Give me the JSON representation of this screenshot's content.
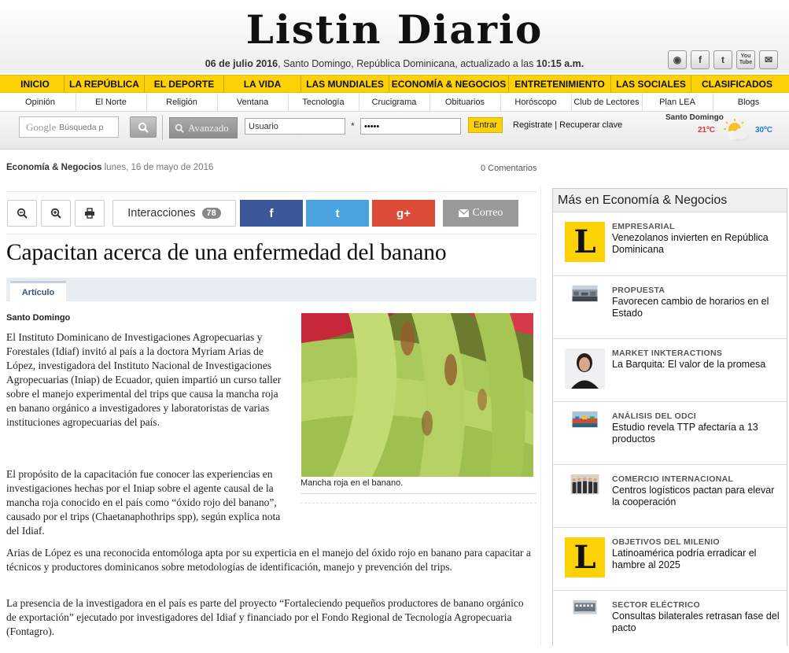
{
  "header": {
    "logo": "Listin Diario",
    "date": "06 de julio 2016",
    "place": ", Santo Domingo, República Dominicana, actualizado a las ",
    "time": "10:15 a.m.",
    "social": [
      "instagram-icon",
      "facebook-icon",
      "twitter-icon",
      "youtube-icon",
      "email-icon"
    ],
    "social_labels": [
      "◉",
      "f",
      "t",
      "You Tube",
      "✉"
    ]
  },
  "nav_primary": [
    "INICIO",
    "LA REPÚBLICA",
    "EL DEPORTE",
    "LA VIDA",
    "LAS MUNDIALES",
    "ECONOMÍA & NEGOCIOS",
    "ENTRETENIMIENTO",
    "LAS SOCIALES",
    "CLASIFICADOS"
  ],
  "nav_secondary": [
    "Opinión",
    "El Norte",
    "Religión",
    "Ventana",
    "Tecnología",
    "Crucigrama",
    "Obituarios",
    "Horóscopo",
    "Club de Lectores",
    "Plan LEA",
    "Blogs"
  ],
  "toolbar": {
    "google_logo": "Google",
    "search_placeholder": "Búsqueda p",
    "advanced": "Avanzado",
    "user_value": "Usuario",
    "star": "*",
    "password_value": "•••••",
    "login_button": "Entrar",
    "register": "Registrate",
    "sep": " | ",
    "recover": "Recuperar clave"
  },
  "weather": {
    "city": "Santo Domingo",
    "low": "21ºC",
    "high": "30ºC"
  },
  "article": {
    "section": "Economía & Negocios",
    "date": " lunes, 16 de mayo de 2016",
    "comments": "0 Comentarios",
    "interactions_label": "Interacciones",
    "interactions_count": "78",
    "share_fb": "f",
    "share_tw": "t",
    "share_gp": "g+",
    "share_mail": "Correo",
    "headline": "Capacitan acerca de una enfermedad del banano",
    "tab": "Artículo",
    "city": "Santo Domingo",
    "paragraphs": [
      "El Instituto Dominicano de Investigaciones Agropecuarias y Forestales (Idiaf) invitó al país a la doctora Myriam Arias de López, investigadora del Instituto Nacional de Investigaciones Agropecuarias (Iniap) de Ecuador, quien impartió un curso taller sobre el manejo experimental del trips que causa la mancha roja en banano orgánico a investigadores y laboratoristas de varias instituciones agropecuarias del país.",
      " El propósito de la capacitación fue conocer las experiencias en investigaciones hechas por el Iniap sobre el agente causal de la mancha roja conocido en el país como “óxido rojo del banano”, causado por el trips (Chaetanaphothrips spp), según explica nota del Idiaf.",
      "Arias de López es una reconocida entomóloga apta por su experticia en el manejo del óxido rojo en banano para capacitar a técnicos y productores dominicanos sobre metodologías de identificación, manejo y prevención del trips.",
      "La presencia de la investigadora en el país es parte del proyecto “Fortaleciendo pequeños productores de banano orgánico de exportación” ejecutado por investigadores del Idiaf y financiado por el  Fondo Regional de Tecnología Agropecuaria (Fontagro)."
    ],
    "caption": "Mancha roja en el banano."
  },
  "sidebar": {
    "title": "Más en Economía & Negocios",
    "logo_letter": "L",
    "items": [
      {
        "category": "EMPRESARIAL",
        "title": "Venezolanos invierten en República Dominicana"
      },
      {
        "category": "PROPUESTA",
        "title": "Favorecen cambio de horarios en el Estado"
      },
      {
        "category": "MARKET INKTERACTIONS",
        "title": "La Barquita: El valor de la promesa"
      },
      {
        "category": "ANÁLISIS DEL ODCI",
        "title": "Estudio revela TTP afectaría a 13 productos"
      },
      {
        "category": "COMERCIO INTERNACIONAL",
        "title": "Centros logísticos pactan para elevar la cooperación"
      },
      {
        "category": "OBJETIVOS DEL MILENIO",
        "title": "Latinoamérica podría erradicar el hambre al 2025"
      },
      {
        "category": "SECTOR ELÉCTRICO",
        "title": "Consultas bilaterales retrasan fase del pacto"
      }
    ]
  },
  "colors": {
    "accent": "#fdd204",
    "facebook": "#3b5998",
    "twitter": "#4aa3df",
    "googleplus": "#dd4b39",
    "mail": "#999999"
  }
}
